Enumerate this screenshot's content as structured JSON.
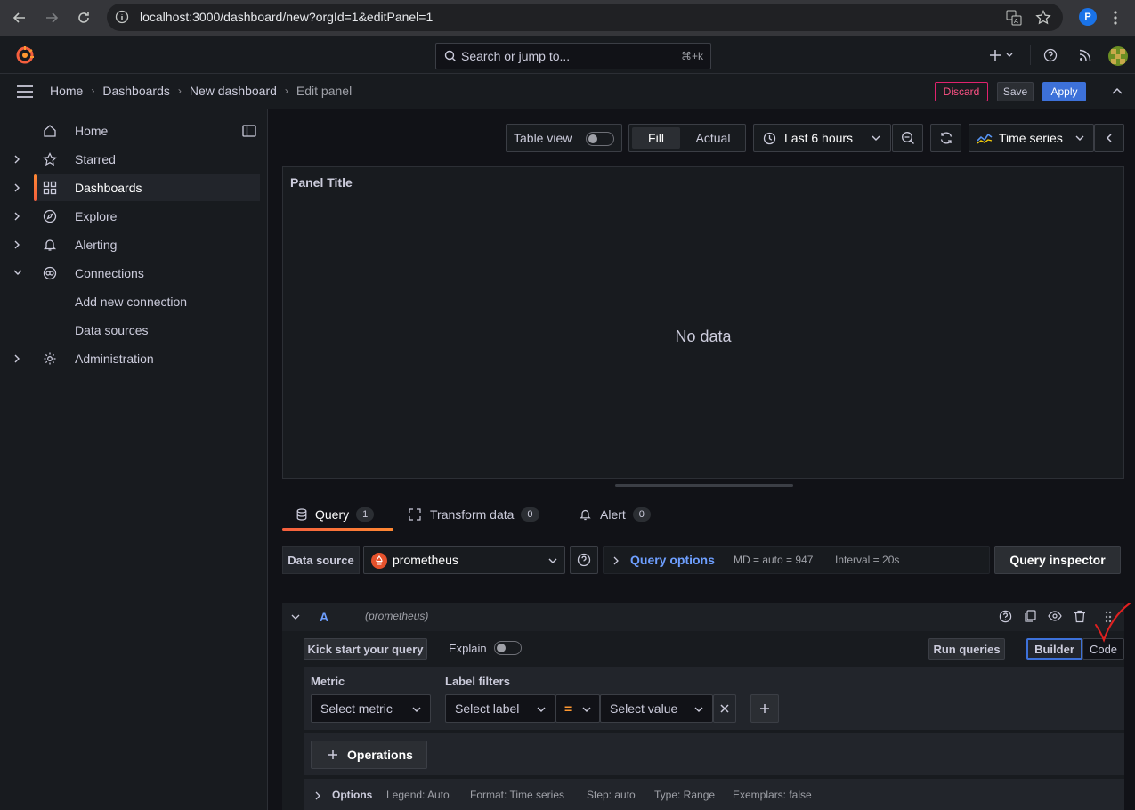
{
  "browser": {
    "url": "localhost:3000/dashboard/new?orgId=1&editPanel=1",
    "profile_initial": "P"
  },
  "topbar": {
    "search_placeholder": "Search or jump to...",
    "search_shortcut": "⌘+k"
  },
  "breadcrumb": {
    "items": [
      "Home",
      "Dashboards",
      "New dashboard",
      "Edit panel"
    ]
  },
  "actions": {
    "discard": "Discard",
    "save": "Save",
    "apply": "Apply"
  },
  "sidebar": {
    "items": [
      {
        "label": "Home",
        "icon": "home-icon"
      },
      {
        "label": "Starred",
        "icon": "star-icon"
      },
      {
        "label": "Dashboards",
        "icon": "grid-icon"
      },
      {
        "label": "Explore",
        "icon": "compass-icon"
      },
      {
        "label": "Alerting",
        "icon": "bell-icon"
      },
      {
        "label": "Connections",
        "icon": "connections-icon"
      },
      {
        "label": "Add new connection"
      },
      {
        "label": "Data sources"
      },
      {
        "label": "Administration",
        "icon": "gear-icon"
      }
    ]
  },
  "toolbar": {
    "table_view": "Table view",
    "fill": "Fill",
    "actual": "Actual",
    "time_range": "Last 6 hours",
    "visualization": "Time series"
  },
  "panel": {
    "title": "Panel Title",
    "empty": "No data"
  },
  "tabs": [
    {
      "label": "Query",
      "count": "1"
    },
    {
      "label": "Transform data",
      "count": "0"
    },
    {
      "label": "Alert",
      "count": "0"
    }
  ],
  "datasource": {
    "label": "Data source",
    "value": "prometheus",
    "query_options": "Query options",
    "md": "MD = auto = 947",
    "interval": "Interval = 20s",
    "inspector": "Query inspector"
  },
  "query": {
    "ref": "A",
    "ds": "(prometheus)",
    "kick_start": "Kick start your query",
    "explain": "Explain",
    "run": "Run queries",
    "builder": "Builder",
    "code": "Code",
    "metric_label": "Metric",
    "metric_placeholder": "Select metric",
    "label_filters": "Label filters",
    "select_label": "Select label",
    "operator": "=",
    "select_value": "Select value",
    "operations": "Operations",
    "options": "Options",
    "legend": "Legend: Auto",
    "format": "Format: Time series",
    "step": "Step: auto",
    "type": "Type: Range",
    "exemplars": "Exemplars: false"
  },
  "colors": {
    "accent": "#3d71d9",
    "brand": "#f55f3e",
    "discard": "#ff5286",
    "annotation": "#e02020"
  }
}
